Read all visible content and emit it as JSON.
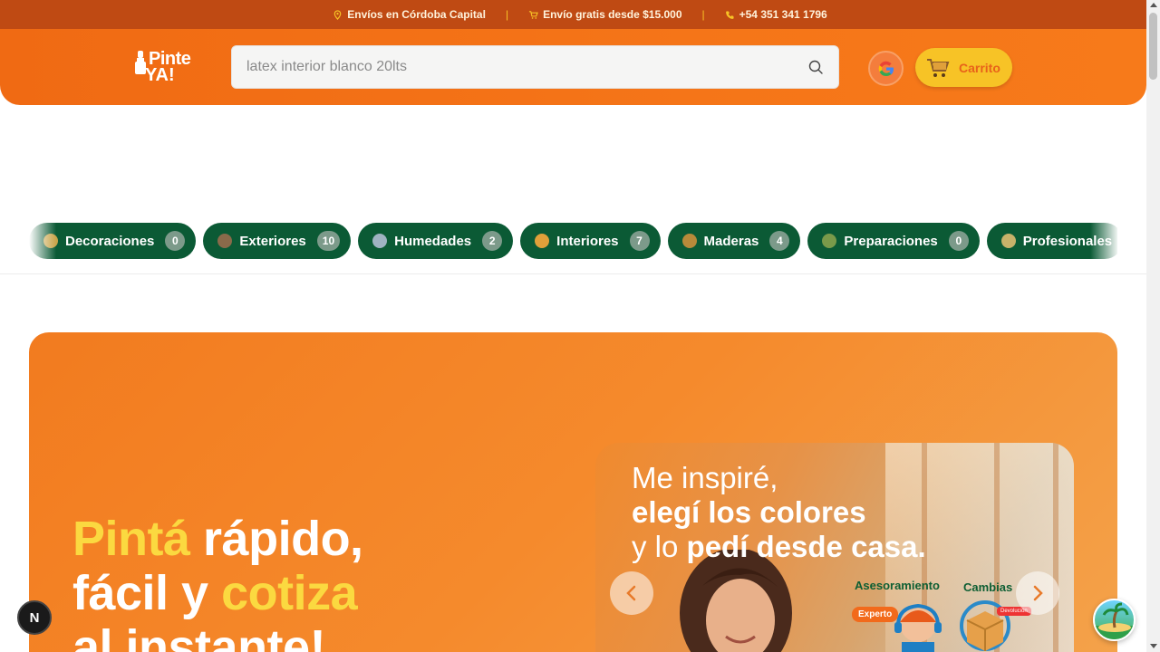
{
  "topbar": {
    "shipping": "Envíos en Córdoba Capital",
    "free_shipping": "Envío gratis desde $15.000",
    "phone": "+54 351 341 1796",
    "separator": "|"
  },
  "header": {
    "logo_line1": "Pinte",
    "logo_line2": "YA!",
    "search_value": "",
    "search_placeholder": "latex interior blanco 20lts",
    "cart_label": "Carrito"
  },
  "categories": [
    {
      "label": "Decoraciones",
      "count": "0",
      "icon_color": "#c9a44a"
    },
    {
      "label": "Exteriores",
      "count": "10",
      "icon_color": "#8a6a4a"
    },
    {
      "label": "Humedades",
      "count": "2",
      "icon_color": "#9fb3c2"
    },
    {
      "label": "Interiores",
      "count": "7",
      "icon_color": "#e0a03a"
    },
    {
      "label": "Maderas",
      "count": "4",
      "icon_color": "#b88a3a"
    },
    {
      "label": "Preparaciones",
      "count": "0",
      "icon_color": "#7a9a4a"
    },
    {
      "label": "Profesionales",
      "count": "",
      "icon_color": "#c8b26a"
    }
  ],
  "hero": {
    "word1": "Pintá",
    "word2": "rápido,",
    "word3": "fácil y",
    "word4": "cotiza",
    "word5": "al instante!"
  },
  "banner": {
    "line1": "Me inspiré,",
    "line2": "elegí los colores",
    "line3a": "y lo ",
    "line3b": "pedí desde casa.",
    "tag_advice": "Asesoramiento",
    "tag_changes": "Cambias",
    "badge_expert": "Experto",
    "badge_return": "Devolución"
  },
  "widgets": {
    "n_button": "N"
  },
  "colors": {
    "topbar": "#bf4a13",
    "header": "#f06a13",
    "accent_yellow": "#f7c326",
    "category_green": "#0b5a35",
    "hero_orange": "#f27b1f"
  }
}
